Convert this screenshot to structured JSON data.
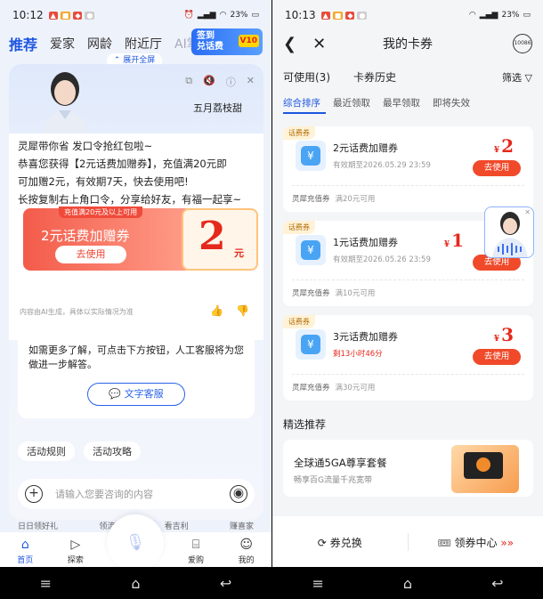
{
  "left": {
    "status": {
      "time": "10:12",
      "battery": "23%"
    },
    "tabs": [
      "推荐",
      "爱家",
      "网龄",
      "附近厅",
      "AI掌"
    ],
    "promo": {
      "line1": "签到",
      "line2": "兑话费",
      "badge": "V10"
    },
    "expand_label": "展开全屏",
    "anchor_name": "五月荔枝甜",
    "message": {
      "line1": "灵犀带你省 发口令抢红包啦~",
      "line2": "恭喜您获得【2元话费加赠券】，充值满20元即",
      "line3": "可加赠2元，有效期7天，快去使用吧!",
      "line4": "长按复制右上角口令，分享给好友，有福一起享~"
    },
    "coupon": {
      "tag": "充值满20元及以上可用",
      "title": "2元话费加赠券",
      "button": "去使用",
      "amount": "2",
      "unit": "元"
    },
    "ai_disclaimer": "内容由AI生成，具体以实际情况为准",
    "help": {
      "text": "如需更多了解，可点击下方按钮，人工客服将为您做进一步解答。",
      "button": "文字客服"
    },
    "chips": [
      "活动规则",
      "活动攻略"
    ],
    "input_placeholder": "请输入您要咨询的内容",
    "peek": [
      "日日领好礼",
      "领流量",
      "看吉利",
      "赚喜家"
    ],
    "bottom_nav": [
      "首页",
      "探索",
      "爱购",
      "我的"
    ]
  },
  "right": {
    "status": {
      "time": "10:13",
      "battery": "23%"
    },
    "title": "我的卡券",
    "service_badge": "10086",
    "tab_available": "可使用(3)",
    "tab_history": "卡券历史",
    "filter": "筛选",
    "sorts": [
      "综合排序",
      "最近领取",
      "最早领取",
      "即将失效"
    ],
    "cards": [
      {
        "label": "话费券",
        "name": "2元话费加赠券",
        "expiry": "有效期至2026.05.29 23:59",
        "amount": "2",
        "currency": "¥",
        "button": "去使用",
        "foot_name": "灵犀充值券",
        "foot_cond": "满20元可用"
      },
      {
        "label": "话费券",
        "name": "1元话费加赠券",
        "expiry": "有效期至2026.05.26 23:59",
        "amount": "1",
        "currency": "¥",
        "button": "去使用",
        "foot_name": "灵犀充值券",
        "foot_cond": "满10元可用"
      },
      {
        "label": "话费券",
        "name": "3元话费加赠券",
        "expiry": "剩13小时46分",
        "amount": "3",
        "currency": "¥",
        "button": "去使用",
        "foot_name": "灵犀充值券",
        "foot_cond": "满30元可用"
      }
    ],
    "recommend_title": "精选推荐",
    "recommend_card": {
      "name": "全球通5GA尊享套餐",
      "desc": "畅享百G流量千兆宽带"
    },
    "bottom": {
      "redeem": "券兑换",
      "center": "领券中心",
      "arrows": "»»"
    }
  },
  "colors": {
    "accent": "#1e56e0",
    "coupon_red": "#e5281c"
  }
}
